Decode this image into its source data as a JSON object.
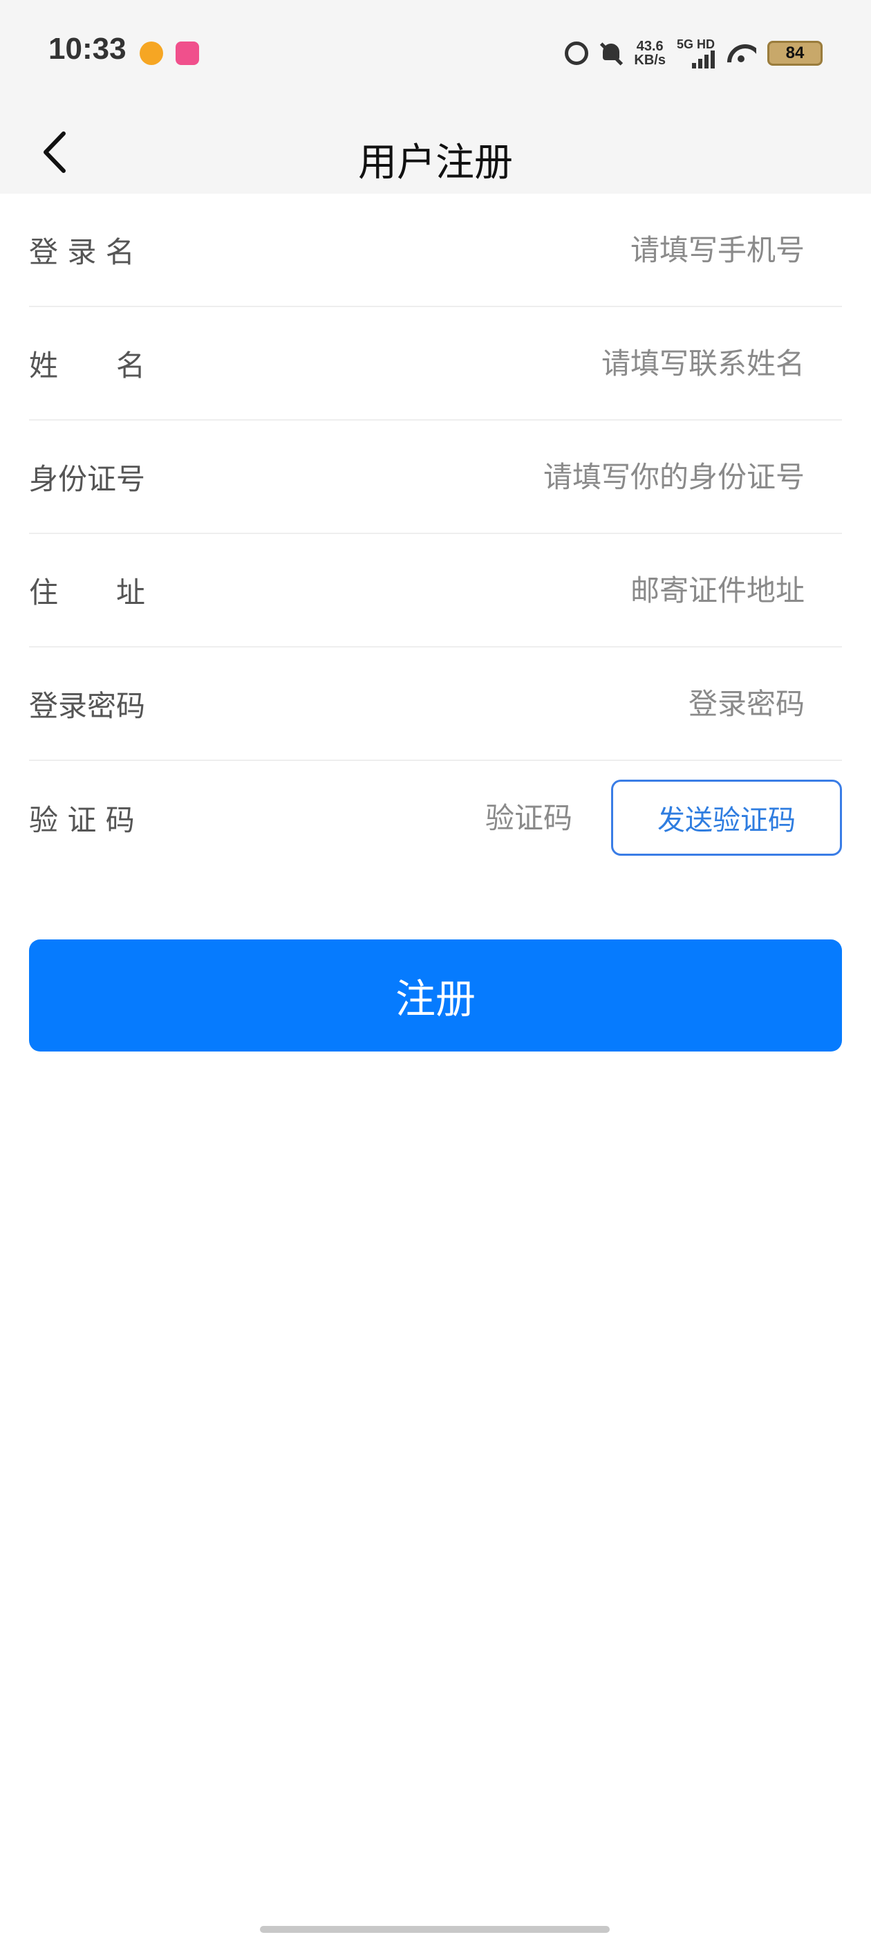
{
  "status_bar": {
    "time": "10:33",
    "net_speed_value": "43.6",
    "net_speed_unit": "KB/s",
    "net_type": "5G HD",
    "battery": "84",
    "icons": [
      "alarm-icon",
      "mute-icon",
      "signal-icon",
      "wifi-icon",
      "battery-icon"
    ]
  },
  "nav": {
    "title": "用户注册",
    "back_icon": "chevron-left-icon"
  },
  "form": {
    "fields": [
      {
        "label": "登 录 名",
        "placeholder": "请填写手机号"
      },
      {
        "label": "姓　　名",
        "placeholder": "请填写联系姓名"
      },
      {
        "label": "身份证号",
        "placeholder": "请填写你的身份证号"
      },
      {
        "label": "住　　址",
        "placeholder": "邮寄证件地址"
      },
      {
        "label": "登录密码",
        "placeholder": "登录密码"
      },
      {
        "label": "验 证 码",
        "placeholder": "验证码"
      }
    ],
    "send_code_label": "发送验证码",
    "submit_label": "注册"
  },
  "colors": {
    "primary": "#067bfe",
    "outline_button": "#3a7de6",
    "header_bg": "#f5f5f5"
  }
}
